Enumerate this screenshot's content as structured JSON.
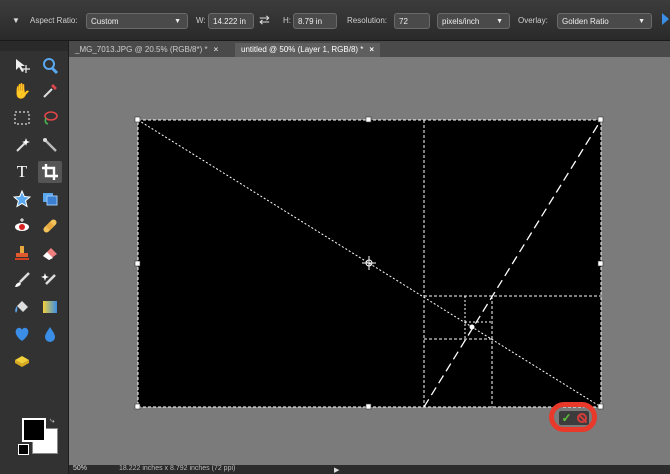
{
  "options_bar": {
    "aspect_ratio_label": "Aspect Ratio:",
    "aspect_ratio_value": "Custom",
    "width_label": "W:",
    "width_value": "14.222 in",
    "height_label": "H:",
    "height_value": "8.79 in",
    "resolution_label": "Resolution:",
    "resolution_value": "72",
    "resolution_unit": "pixels/inch",
    "overlay_label": "Overlay:",
    "overlay_value": "Golden Ratio"
  },
  "tabs": [
    {
      "label": "_MG_7013.JPG @ 20.5% (RGB/8*) *",
      "close": "×"
    },
    {
      "label": "untitled @ 50% (Layer 1, RGB/8) *",
      "close": "×"
    }
  ],
  "status_bar": {
    "zoom": "50%",
    "doc_size": "18.222 inches x 8.792 inches (72 ppi)"
  },
  "colors": {
    "foreground": "#000000",
    "background": "#ffffff",
    "highlight_ring": "#e8392a",
    "commit": "#5ec43a",
    "cancel": "#d43c3c"
  },
  "tools": [
    "move-icon",
    "zoom-icon",
    "hand-icon",
    "eyedropper-icon",
    "marquee-icon",
    "lasso-icon",
    "magic-wand-icon",
    "quick-selection-icon",
    "type-icon",
    "crop-icon",
    "custom-shape-icon",
    "recompose-icon",
    "red-eye-icon",
    "healing-brush-icon",
    "clone-stamp-icon",
    "eraser-icon",
    "brush-icon",
    "smart-brush-icon",
    "paint-bucket-icon",
    "gradient-icon",
    "color-replacement-icon",
    "blur-icon",
    "sponge-icon"
  ]
}
